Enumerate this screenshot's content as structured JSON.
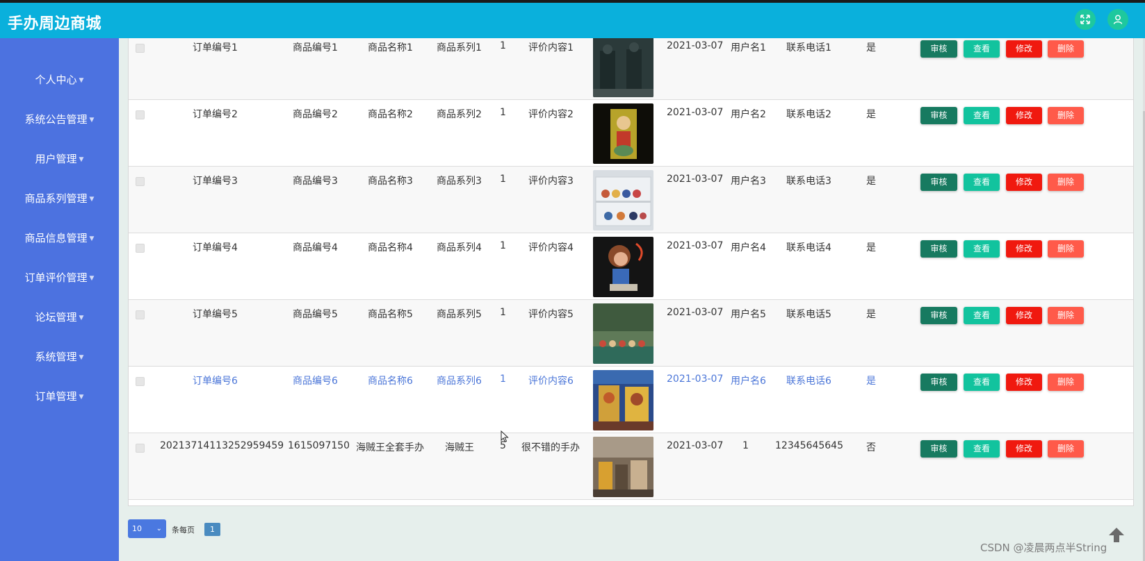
{
  "header": {
    "title": "手办周边商城"
  },
  "sidebar": {
    "items": [
      {
        "label": "个人中心"
      },
      {
        "label": "系统公告管理"
      },
      {
        "label": "用户管理"
      },
      {
        "label": "商品系列管理"
      },
      {
        "label": "商品信息管理"
      },
      {
        "label": "订单评价管理"
      },
      {
        "label": "论坛管理"
      },
      {
        "label": "系统管理"
      },
      {
        "label": "订单管理"
      }
    ]
  },
  "table": {
    "buttons": {
      "audit": "审核",
      "view": "查看",
      "edit": "修改",
      "delete": "删除"
    },
    "rows": [
      {
        "order_no": "订单编号1",
        "goods_no": "商品编号1",
        "goods_name": "商品名称1",
        "series": "商品系列1",
        "qty": "1",
        "review": "评价内容1",
        "date": "2021-03-07",
        "username": "用户名1",
        "phone": "联系电话1",
        "approved": "是"
      },
      {
        "order_no": "订单编号2",
        "goods_no": "商品编号2",
        "goods_name": "商品名称2",
        "series": "商品系列2",
        "qty": "1",
        "review": "评价内容2",
        "date": "2021-03-07",
        "username": "用户名2",
        "phone": "联系电话2",
        "approved": "是"
      },
      {
        "order_no": "订单编号3",
        "goods_no": "商品编号3",
        "goods_name": "商品名称3",
        "series": "商品系列3",
        "qty": "1",
        "review": "评价内容3",
        "date": "2021-03-07",
        "username": "用户名3",
        "phone": "联系电话3",
        "approved": "是"
      },
      {
        "order_no": "订单编号4",
        "goods_no": "商品编号4",
        "goods_name": "商品名称4",
        "series": "商品系列4",
        "qty": "1",
        "review": "评价内容4",
        "date": "2021-03-07",
        "username": "用户名4",
        "phone": "联系电话4",
        "approved": "是"
      },
      {
        "order_no": "订单编号5",
        "goods_no": "商品编号5",
        "goods_name": "商品名称5",
        "series": "商品系列5",
        "qty": "1",
        "review": "评价内容5",
        "date": "2021-03-07",
        "username": "用户名5",
        "phone": "联系电话5",
        "approved": "是"
      },
      {
        "order_no": "订单编号6",
        "goods_no": "商品编号6",
        "goods_name": "商品名称6",
        "series": "商品系列6",
        "qty": "1",
        "review": "评价内容6",
        "date": "2021-03-07",
        "username": "用户名6",
        "phone": "联系电话6",
        "approved": "是"
      },
      {
        "order_no": "20213714113252959459",
        "goods_no": "1615097150",
        "goods_name": "海贼王全套手办",
        "series": "海贼王",
        "qty": "5",
        "review": "很不错的手办",
        "date": "2021-03-07",
        "username": "1",
        "phone": "12345645645",
        "approved": "否"
      }
    ]
  },
  "pagination": {
    "page_size": "10",
    "per_page_label": "条每页",
    "current_page": "1"
  },
  "watermark": "CSDN @凌晨两点半String",
  "colors": {
    "topbar": "#0ab0dc",
    "sidebar": "#4c72e0",
    "audit": "#177a60",
    "view": "#12c39e",
    "edit": "#f0190f",
    "delete": "#ff5a4a",
    "highlight_text": "#4b76d8"
  }
}
